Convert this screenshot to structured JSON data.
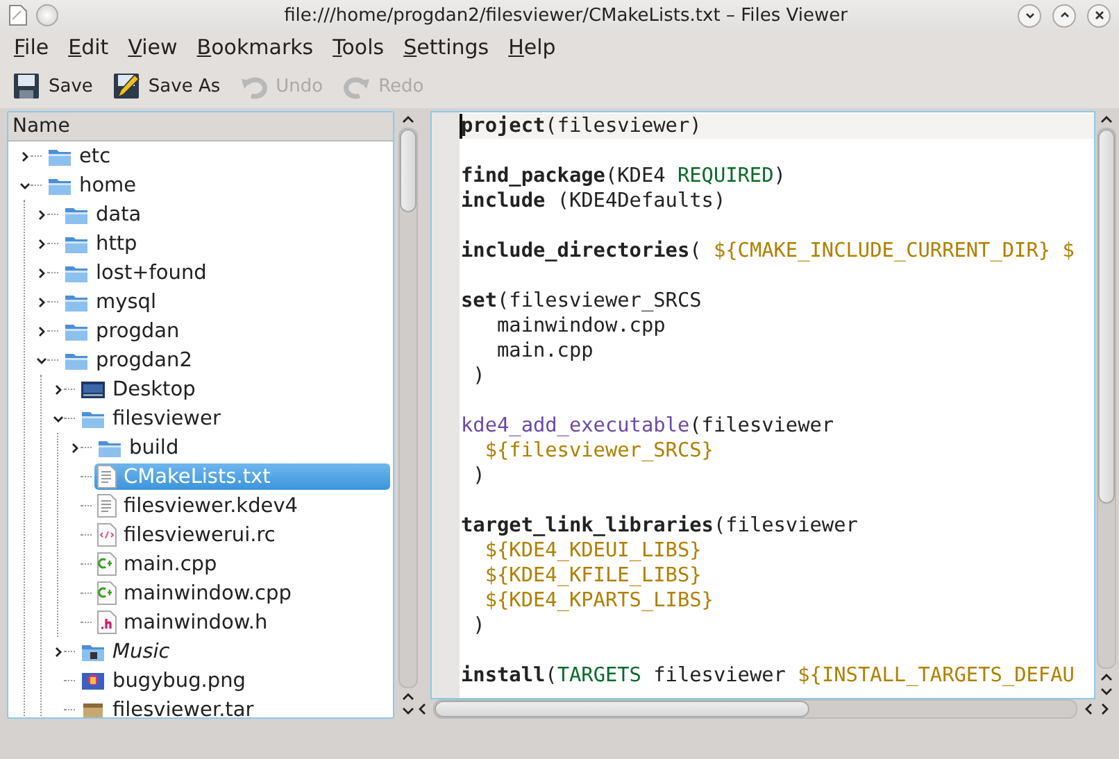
{
  "window": {
    "title": "file:///home/progdan2/filesviewer/CMakeLists.txt – Files Viewer"
  },
  "menu": [
    "File",
    "Edit",
    "View",
    "Bookmarks",
    "Tools",
    "Settings",
    "Help"
  ],
  "toolbar": [
    {
      "label": "Save",
      "kind": "save",
      "disabled": false
    },
    {
      "label": "Save As",
      "kind": "save-as",
      "disabled": false
    },
    {
      "label": "Undo",
      "kind": "undo",
      "disabled": true
    },
    {
      "label": "Redo",
      "kind": "redo",
      "disabled": true
    }
  ],
  "tree": {
    "header": "Name",
    "items": [
      {
        "name": "etc",
        "kind": "folder",
        "expanded": false,
        "selected": false
      },
      {
        "name": "home",
        "kind": "folder",
        "expanded": true,
        "selected": false,
        "children": [
          {
            "name": "data",
            "kind": "folder",
            "expanded": false,
            "selected": false
          },
          {
            "name": "http",
            "kind": "folder",
            "expanded": false,
            "selected": false
          },
          {
            "name": "lost+found",
            "kind": "folder",
            "expanded": false,
            "selected": false
          },
          {
            "name": "mysql",
            "kind": "folder",
            "expanded": false,
            "selected": false
          },
          {
            "name": "progdan",
            "kind": "folder",
            "expanded": false,
            "selected": false
          },
          {
            "name": "progdan2",
            "kind": "folder",
            "expanded": true,
            "selected": false,
            "children": [
              {
                "name": "Desktop",
                "kind": "desktop",
                "expanded": false,
                "selected": false
              },
              {
                "name": "filesviewer",
                "kind": "folder",
                "expanded": true,
                "selected": false,
                "children": [
                  {
                    "name": "build",
                    "kind": "folder",
                    "expanded": false,
                    "selected": false
                  },
                  {
                    "name": "CMakeLists.txt",
                    "kind": "text",
                    "selected": true
                  },
                  {
                    "name": "filesviewer.kdev4",
                    "kind": "text",
                    "selected": false
                  },
                  {
                    "name": "filesviewerui.rc",
                    "kind": "xml",
                    "selected": false
                  },
                  {
                    "name": "main.cpp",
                    "kind": "cpp",
                    "selected": false
                  },
                  {
                    "name": "mainwindow.cpp",
                    "kind": "cpp",
                    "selected": false
                  },
                  {
                    "name": "mainwindow.h",
                    "kind": "header",
                    "selected": false
                  }
                ]
              },
              {
                "name": "Music",
                "kind": "link-folder",
                "expanded": false,
                "selected": false
              },
              {
                "name": "bugybug.png",
                "kind": "image",
                "selected": false
              },
              {
                "name": "filesviewer.tar",
                "kind": "archive",
                "selected": false
              }
            ]
          }
        ]
      }
    ]
  },
  "editor": {
    "lines": [
      {
        "current": true,
        "segments": [
          {
            "text": "project",
            "kind": "keyword"
          },
          {
            "text": "(filesviewer)",
            "kind": "plain"
          }
        ]
      },
      {
        "current": false
      },
      {
        "current": false,
        "segments": [
          {
            "text": "find_package",
            "kind": "keyword"
          },
          {
            "text": "(KDE4 ",
            "kind": "plain"
          },
          {
            "text": "REQUIRED",
            "kind": "constant"
          },
          {
            "text": ")",
            "kind": "plain"
          }
        ]
      },
      {
        "current": false,
        "segments": [
          {
            "text": "include",
            "kind": "keyword"
          },
          {
            "text": " (KDE4Defaults)",
            "kind": "plain"
          }
        ]
      },
      {
        "current": false
      },
      {
        "current": false,
        "segments": [
          {
            "text": "include_directories",
            "kind": "keyword"
          },
          {
            "text": "( ",
            "kind": "plain"
          },
          {
            "text": "${CMAKE_INCLUDE_CURRENT_DIR} $",
            "kind": "variable"
          }
        ]
      },
      {
        "current": false
      },
      {
        "current": false,
        "segments": [
          {
            "text": "set",
            "kind": "keyword"
          },
          {
            "text": "(filesviewer_SRCS",
            "kind": "plain"
          }
        ]
      },
      {
        "current": false,
        "segments": [
          {
            "text": "   mainwindow.cpp",
            "kind": "plain"
          }
        ]
      },
      {
        "current": false,
        "segments": [
          {
            "text": "   main.cpp",
            "kind": "plain"
          }
        ]
      },
      {
        "current": false,
        "segments": [
          {
            "text": " )",
            "kind": "plain"
          }
        ]
      },
      {
        "current": false
      },
      {
        "current": false,
        "segments": [
          {
            "text": "kde4_add_executable",
            "kind": "function"
          },
          {
            "text": "(filesviewer",
            "kind": "plain"
          }
        ]
      },
      {
        "current": false,
        "segments": [
          {
            "text": "  ${filesviewer_SRCS}",
            "kind": "variable"
          }
        ]
      },
      {
        "current": false,
        "segments": [
          {
            "text": " )",
            "kind": "plain"
          }
        ]
      },
      {
        "current": false
      },
      {
        "current": false,
        "segments": [
          {
            "text": "target_link_libraries",
            "kind": "keyword"
          },
          {
            "text": "(filesviewer",
            "kind": "plain"
          }
        ]
      },
      {
        "current": false,
        "segments": [
          {
            "text": "  ${KDE4_KDEUI_LIBS}",
            "kind": "variable"
          }
        ]
      },
      {
        "current": false,
        "segments": [
          {
            "text": "  ${KDE4_KFILE_LIBS}",
            "kind": "variable"
          }
        ]
      },
      {
        "current": false,
        "segments": [
          {
            "text": "  ${KDE4_KPARTS_LIBS}",
            "kind": "variable"
          }
        ]
      },
      {
        "current": false,
        "segments": [
          {
            "text": " )",
            "kind": "plain"
          }
        ]
      },
      {
        "current": false
      },
      {
        "current": false,
        "segments": [
          {
            "text": "install",
            "kind": "keyword"
          },
          {
            "text": "(",
            "kind": "plain"
          },
          {
            "text": "TARGETS",
            "kind": "constant"
          },
          {
            "text": " filesviewer ",
            "kind": "plain"
          },
          {
            "text": "${INSTALL_TARGETS_DEFAU",
            "kind": "variable"
          }
        ]
      }
    ]
  }
}
